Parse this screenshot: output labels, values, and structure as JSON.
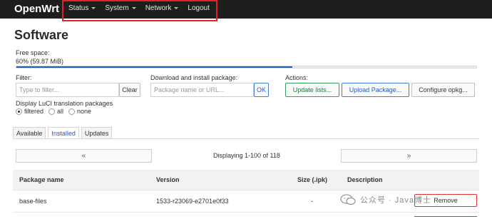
{
  "brand": "OpenWrt",
  "nav": [
    {
      "label": "Status",
      "has_caret": true
    },
    {
      "label": "System",
      "has_caret": true
    },
    {
      "label": "Network",
      "has_caret": true
    },
    {
      "label": "Logout",
      "has_caret": false
    }
  ],
  "page_title": "Software",
  "free_space": {
    "label": "Free space:",
    "value": "60% (59.87 MiB)",
    "fraction": 0.6
  },
  "filter": {
    "label": "Filter:",
    "placeholder": "Type to filter...",
    "clear_label": "Clear"
  },
  "download": {
    "label": "Download and install package:",
    "placeholder": "Package name or URL...",
    "ok_label": "OK"
  },
  "actions": {
    "label": "Actions:",
    "update_label": "Update lists...",
    "upload_label": "Upload Package...",
    "configure_label": "Configure opkg..."
  },
  "translation": {
    "label": "Display LuCI translation packages",
    "options": [
      "filtered",
      "all",
      "none"
    ],
    "selected": "filtered"
  },
  "tabs": [
    {
      "label": "Available",
      "active": false
    },
    {
      "label": "Installed",
      "active": true
    },
    {
      "label": "Updates",
      "active": false
    }
  ],
  "pager": {
    "prev": "«",
    "next": "»",
    "text": "Displaying 1-100 of 118"
  },
  "table": {
    "headers": [
      "Package name",
      "Version",
      "Size (.ipk)",
      "Description"
    ],
    "rows": [
      {
        "name": "base-files",
        "version": "1533-r23069-e2701e0f33",
        "size": "-",
        "action": "Remove"
      }
    ]
  },
  "watermark": {
    "text": "公众号 · Java博士"
  },
  "colors": {
    "nav_bg": "#1e1e1e",
    "highlight": "#e0242a",
    "progress": "#1f5cc4",
    "update_btn": "#33a05a",
    "upload_btn": "#3b7fd4"
  }
}
